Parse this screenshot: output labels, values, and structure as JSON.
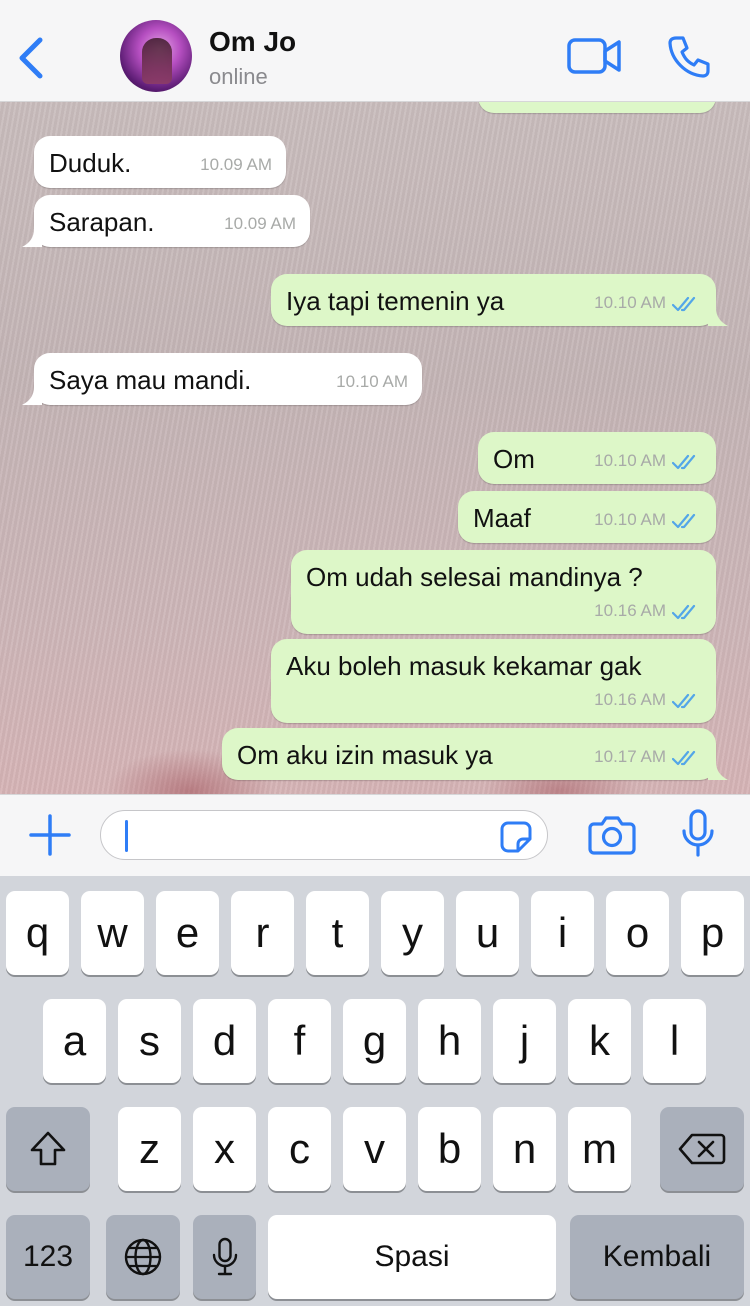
{
  "header": {
    "contact_name": "Om Jo",
    "contact_status": "online"
  },
  "messages": [
    {
      "direction": "in",
      "text": "Duduk.",
      "time": "10.09 AM"
    },
    {
      "direction": "in",
      "text": "Sarapan.",
      "time": "10.09 AM"
    },
    {
      "direction": "out",
      "text": "Iya tapi temenin ya",
      "time": "10.10 AM",
      "read": true
    },
    {
      "direction": "in",
      "text": "Saya mau mandi.",
      "time": "10.10 AM"
    },
    {
      "direction": "out",
      "text": "Om",
      "time": "10.10 AM",
      "read": true
    },
    {
      "direction": "out",
      "text": "Maaf",
      "time": "10.10 AM",
      "read": true
    },
    {
      "direction": "out",
      "text": "Om udah selesai mandinya ?",
      "time": "10.16 AM",
      "read": true
    },
    {
      "direction": "out",
      "text": "Aku boleh masuk kekamar gak",
      "time": "10.16 AM",
      "read": true
    },
    {
      "direction": "out",
      "text": "Om aku izin masuk ya",
      "time": "10.17 AM",
      "read": true
    }
  ],
  "input": {
    "value": ""
  },
  "keyboard": {
    "row1": [
      "q",
      "w",
      "e",
      "r",
      "t",
      "y",
      "u",
      "i",
      "o",
      "p"
    ],
    "row2": [
      "a",
      "s",
      "d",
      "f",
      "g",
      "h",
      "j",
      "k",
      "l"
    ],
    "row3": [
      "z",
      "x",
      "c",
      "v",
      "b",
      "n",
      "m"
    ],
    "numbers_label": "123",
    "space_label": "Spasi",
    "return_label": "Kembali"
  },
  "colors": {
    "accent": "#2f7df6",
    "outgoing_bubble": "#ddf7c8",
    "incoming_bubble": "#ffffff",
    "read_ticks": "#53a6e8"
  },
  "icons": [
    "chevron-left-icon",
    "video-camera-icon",
    "phone-icon",
    "plus-icon",
    "sticker-icon",
    "camera-icon",
    "microphone-icon",
    "shift-icon",
    "backspace-icon",
    "globe-icon",
    "keyboard-mic-icon",
    "double-check-icon"
  ]
}
